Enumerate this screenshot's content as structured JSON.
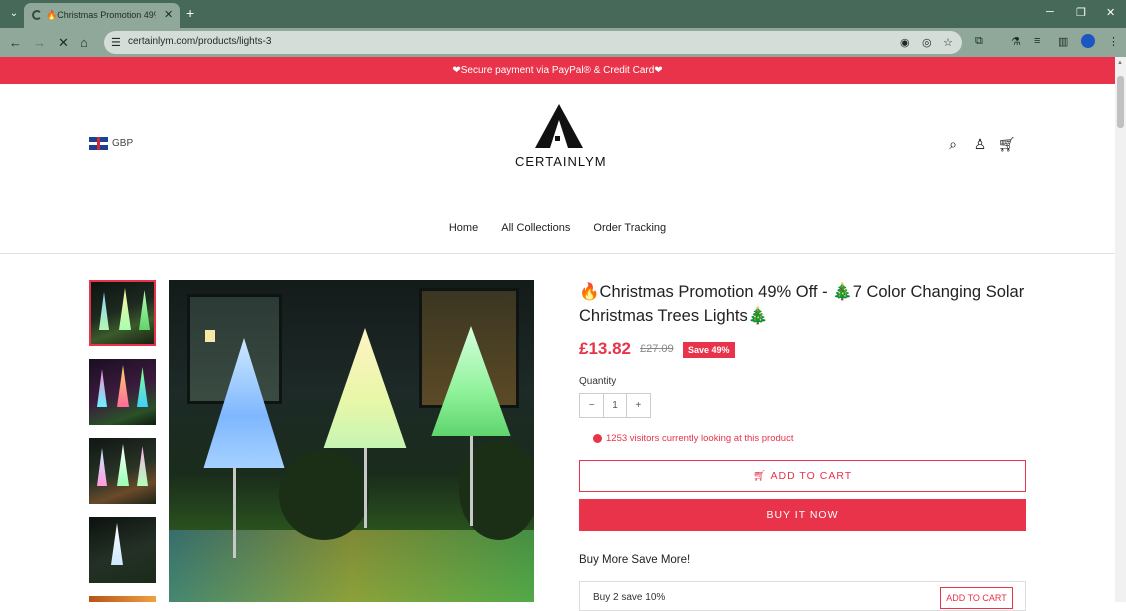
{
  "browser": {
    "tab_title": "🔥Christmas Promotion 49% O",
    "url": "certainlym.com/products/lights-3"
  },
  "announcement": "❤Secure payment via PayPal® & Credit Card❤",
  "header": {
    "currency": "GBP",
    "logo_text": "CERTAINLYM"
  },
  "nav": {
    "items": [
      "Home",
      "All Collections",
      "Order Tracking"
    ]
  },
  "product": {
    "title": "🔥Christmas Promotion 49% Off - 🎄7 Color Changing Solar Christmas Trees Lights🎄",
    "price": "£13.82",
    "compare_price": "£27.09",
    "badge": "Save 49%",
    "quantity_label": "Quantity",
    "quantity_value": "1",
    "visitors_text": "1253 visitors currently looking at this product",
    "add_to_cart": "ADD TO CART",
    "buy_now": "BUY IT NOW",
    "bundle_heading": "Buy More Save More!",
    "bundle_offer": "Buy 2 save 10%",
    "bundle_button": "ADD TO CART"
  },
  "colors": {
    "brand": "#e8334a",
    "chrome": "#46695a"
  }
}
